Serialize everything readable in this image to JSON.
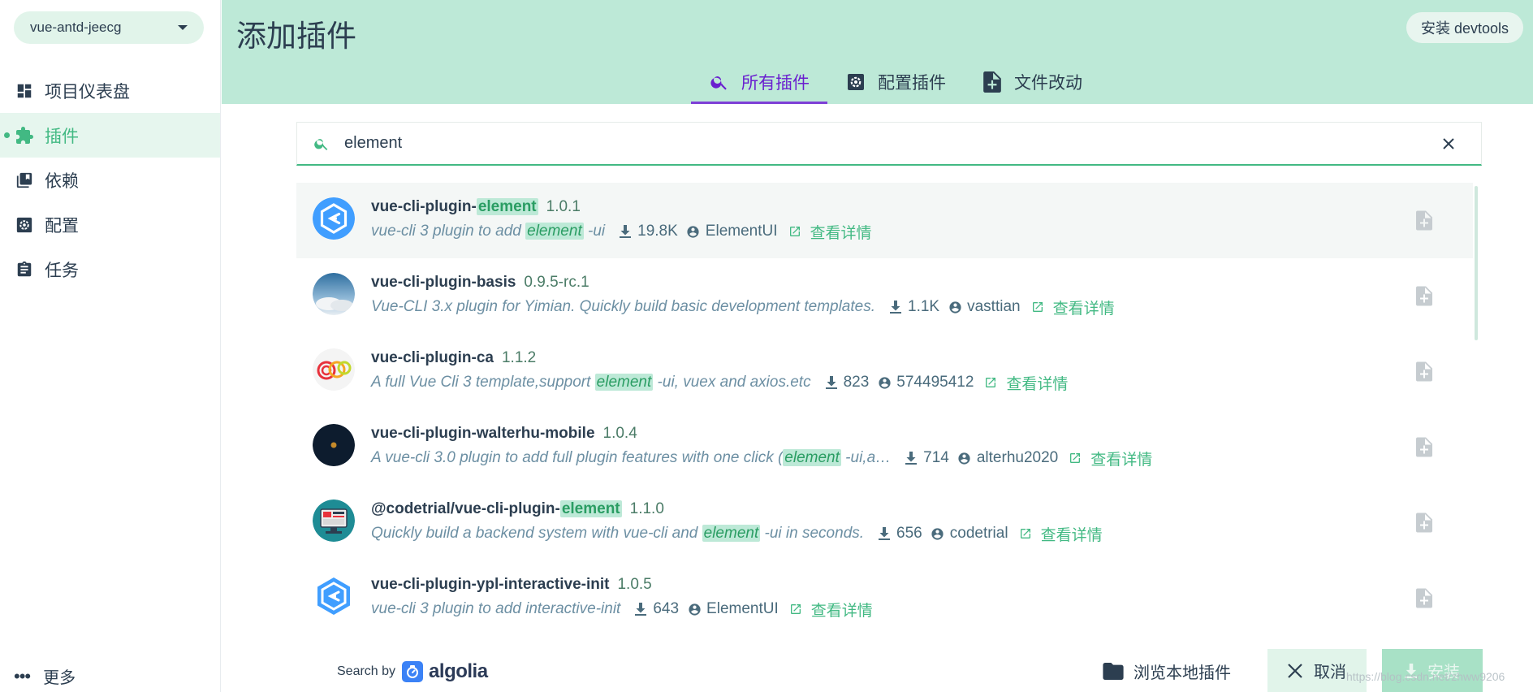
{
  "sidebar": {
    "project": "vue-antd-jeecg",
    "items": [
      {
        "label": "项目仪表盘",
        "icon": "dashboard-icon"
      },
      {
        "label": "插件",
        "icon": "puzzle-icon",
        "active": true
      },
      {
        "label": "依赖",
        "icon": "library-icon"
      },
      {
        "label": "配置",
        "icon": "settings-icon"
      },
      {
        "label": "任务",
        "icon": "clipboard-icon"
      }
    ],
    "more_label": "更多"
  },
  "header": {
    "title": "添加插件",
    "devtools_label": "安装 devtools",
    "tabs": [
      {
        "label": "所有插件",
        "icon": "search-icon",
        "active": true
      },
      {
        "label": "配置插件",
        "icon": "gear-icon"
      },
      {
        "label": "文件改动",
        "icon": "file-plus-icon"
      }
    ]
  },
  "search": {
    "value": "element"
  },
  "results": [
    {
      "name_pre": "vue-cli-plugin-",
      "name_hl": "element",
      "name_post": "",
      "version": "1.0.1",
      "desc_pre": "vue-cli 3 plugin to add ",
      "desc_hl": "element",
      "desc_post": " -ui",
      "downloads": "19.8K",
      "author": "ElementUI",
      "detail": "查看详情",
      "logo": "element-logo"
    },
    {
      "name_pre": "vue-cli-plugin-basis",
      "name_hl": "",
      "name_post": "",
      "version": "0.9.5-rc.1",
      "desc_pre": "Vue-CLI 3.x plugin for Yimian. Quickly build basic development templates.",
      "desc_hl": "",
      "desc_post": "",
      "downloads": "1.1K",
      "author": "vasttian",
      "detail": "查看详情",
      "logo": "sky-avatar"
    },
    {
      "name_pre": "vue-cli-plugin-ca",
      "name_hl": "",
      "name_post": "",
      "version": "1.1.2",
      "desc_pre": "A full Vue Cli 3 template,support ",
      "desc_hl": "element",
      "desc_post": " -ui, vuex and axios.etc",
      "downloads": "823",
      "author": "574495412",
      "detail": "查看详情",
      "logo": "rings-logo"
    },
    {
      "name_pre": "vue-cli-plugin-walterhu-mobile",
      "name_hl": "",
      "name_post": "",
      "version": "1.0.4",
      "desc_pre": "A vue-cli 3.0 plugin to add full plugin features with one click (",
      "desc_hl": "element",
      "desc_post": " -ui,a…",
      "downloads": "714",
      "author": "alterhu2020",
      "detail": "查看详情",
      "logo": "dark-avatar"
    },
    {
      "name_pre": "@codetrial/vue-cli-plugin-",
      "name_hl": "element",
      "name_post": "",
      "version": "1.1.0",
      "desc_pre": "Quickly build a backend system with vue-cli and ",
      "desc_hl": "element",
      "desc_post": " -ui in seconds.",
      "downloads": "656",
      "author": "codetrial",
      "detail": "查看详情",
      "logo": "monitor-avatar"
    },
    {
      "name_pre": "vue-cli-plugin-ypl-interactive-init",
      "name_hl": "",
      "name_post": "",
      "version": "1.0.5",
      "desc_pre": "vue-cli 3 plugin to add interactive-init",
      "desc_hl": "",
      "desc_post": "",
      "downloads": "643",
      "author": "ElementUI",
      "detail": "查看详情",
      "logo": "element-logo"
    }
  ],
  "footer": {
    "search_by": "Search by",
    "algolia": "algolia",
    "browse_label": "浏览本地插件",
    "cancel_label": "取消",
    "install_label": "安装",
    "watermark": "https://blog.csdn.net/zhww9206"
  },
  "colors": {
    "accent": "#42b983",
    "header_bg": "#bde9d7",
    "tab_active": "#6a1fcf",
    "highlight_bg": "#bde9d7"
  }
}
